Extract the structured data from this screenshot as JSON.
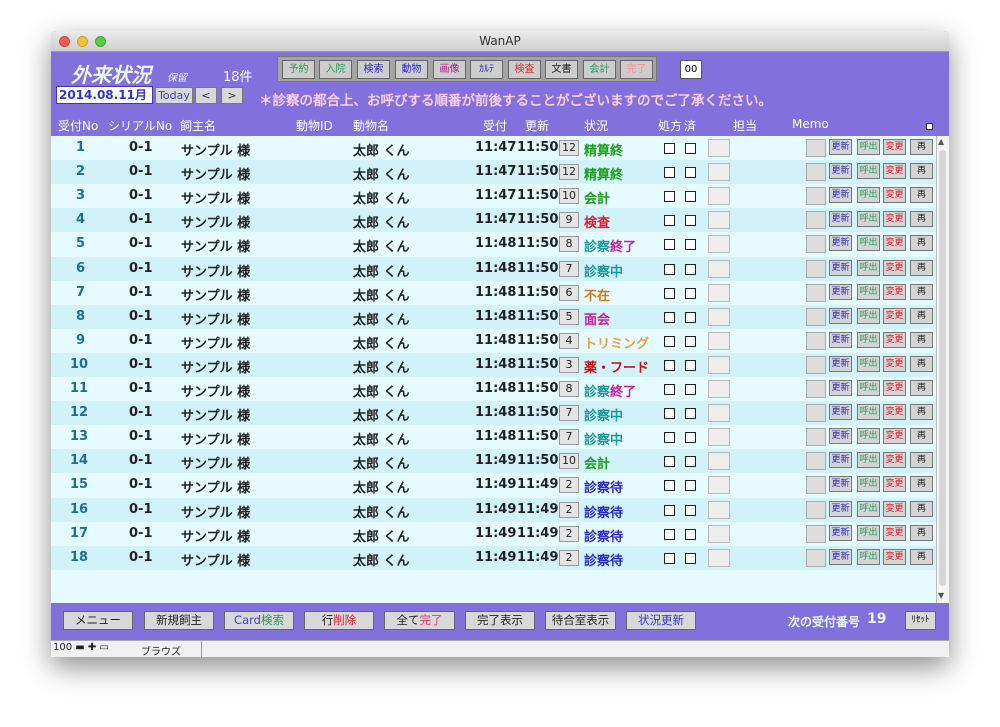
{
  "window": {
    "title": "WanAP"
  },
  "header": {
    "app_title": "外来状況",
    "hold_label": "保留",
    "count_label": "18件",
    "toolbar": [
      {
        "label": "予約",
        "color": "#2a9a55"
      },
      {
        "label": "入院",
        "color": "#2a9a55"
      },
      {
        "label": "検索",
        "color": "#2a2acc"
      },
      {
        "label": "動物",
        "color": "#2a2acc"
      },
      {
        "label": "画像",
        "color": "#b0208a"
      },
      {
        "label": "ｶﾙﾃ",
        "color": "#2a2acc"
      },
      {
        "label": "検査",
        "color": "#e03030"
      },
      {
        "label": "文書",
        "color": "#222222"
      },
      {
        "label": "会計",
        "color": "#2a9a55"
      },
      {
        "label": "完了",
        "color": "#ff9090"
      }
    ],
    "box_value": "00",
    "date": "2014.08.11月",
    "today_label": "Today",
    "prev_label": "<",
    "next_label": ">",
    "notice": "＊診察の都合上、お呼びする順番が前後することがございますのでご了承ください。"
  },
  "columns": {
    "reception_no": "受付No",
    "serial_no": "シリアルNo",
    "owner": "飼主名",
    "animal_id": "動物ID",
    "animal_name": "動物名",
    "received": "受付",
    "updated": "更新",
    "status": "状況",
    "prescription": "処方",
    "done": "済",
    "staff": "担当",
    "memo": "Memo"
  },
  "row_buttons": {
    "update": "更新",
    "call": "呼出",
    "change": "変更",
    "re": "再"
  },
  "rows": [
    {
      "no": "1",
      "serial": "0-1",
      "owner": "サンプル 様",
      "animal": "太郎 くん",
      "received": "11:47",
      "updated": "11:50",
      "code": "12",
      "status": "精算終",
      "status_color": "#1aa01a"
    },
    {
      "no": "2",
      "serial": "0-1",
      "owner": "サンプル 様",
      "animal": "太郎 くん",
      "received": "11:47",
      "updated": "11:50",
      "code": "12",
      "status": "精算終",
      "status_color": "#1aa01a"
    },
    {
      "no": "3",
      "serial": "0-1",
      "owner": "サンプル 様",
      "animal": "太郎 くん",
      "received": "11:47",
      "updated": "11:50",
      "code": "10",
      "status": "会計",
      "status_color": "#1aa01a"
    },
    {
      "no": "4",
      "serial": "0-1",
      "owner": "サンプル 様",
      "animal": "太郎 くん",
      "received": "11:47",
      "updated": "11:50",
      "code": "9",
      "status": "検査",
      "status_color": "#e0202a"
    },
    {
      "no": "5",
      "serial": "0-1",
      "owner": "サンプル 様",
      "animal": "太郎 くん",
      "received": "11:48",
      "updated": "11:50",
      "code": "8",
      "status": "診察",
      "status2": "終了",
      "status_color": "#1a9a9a",
      "status2_color": "#cc1aa0"
    },
    {
      "no": "6",
      "serial": "0-1",
      "owner": "サンプル 様",
      "animal": "太郎 くん",
      "received": "11:48",
      "updated": "11:50",
      "code": "7",
      "status": "診察中",
      "status_color": "#1a9a9a"
    },
    {
      "no": "7",
      "serial": "0-1",
      "owner": "サンプル 様",
      "animal": "太郎 くん",
      "received": "11:48",
      "updated": "11:50",
      "code": "6",
      "status": "不在",
      "status_color": "#d07a10"
    },
    {
      "no": "8",
      "serial": "0-1",
      "owner": "サンプル 様",
      "animal": "太郎 くん",
      "received": "11:48",
      "updated": "11:50",
      "code": "5",
      "status": "面会",
      "status_color": "#cc1aa0"
    },
    {
      "no": "9",
      "serial": "0-1",
      "owner": "サンプル 様",
      "animal": "太郎 くん",
      "received": "11:48",
      "updated": "11:50",
      "code": "4",
      "status": "トリミング",
      "status_color": "#f0a040"
    },
    {
      "no": "10",
      "serial": "0-1",
      "owner": "サンプル 様",
      "animal": "太郎 くん",
      "received": "11:48",
      "updated": "11:50",
      "code": "3",
      "status": "薬・フード",
      "status_color": "#cc1010"
    },
    {
      "no": "11",
      "serial": "0-1",
      "owner": "サンプル 様",
      "animal": "太郎 くん",
      "received": "11:48",
      "updated": "11:50",
      "code": "8",
      "status": "診察",
      "status2": "終了",
      "status_color": "#1a9a9a",
      "status2_color": "#cc1aa0"
    },
    {
      "no": "12",
      "serial": "0-1",
      "owner": "サンプル 様",
      "animal": "太郎 くん",
      "received": "11:48",
      "updated": "11:50",
      "code": "7",
      "status": "診察中",
      "status_color": "#1a9a9a"
    },
    {
      "no": "13",
      "serial": "0-1",
      "owner": "サンプル 様",
      "animal": "太郎 くん",
      "received": "11:48",
      "updated": "11:50",
      "code": "7",
      "status": "診察中",
      "status_color": "#1a9a9a"
    },
    {
      "no": "14",
      "serial": "0-1",
      "owner": "サンプル 様",
      "animal": "太郎 くん",
      "received": "11:49",
      "updated": "11:50",
      "code": "10",
      "status": "会計",
      "status_color": "#1aa01a"
    },
    {
      "no": "15",
      "serial": "0-1",
      "owner": "サンプル 様",
      "animal": "太郎 くん",
      "received": "11:49",
      "updated": "11:49",
      "code": "2",
      "status": "診察待",
      "status_color": "#2a2acc"
    },
    {
      "no": "16",
      "serial": "0-1",
      "owner": "サンプル 様",
      "animal": "太郎 くん",
      "received": "11:49",
      "updated": "11:49",
      "code": "2",
      "status": "診察待",
      "status_color": "#2a2acc"
    },
    {
      "no": "17",
      "serial": "0-1",
      "owner": "サンプル 様",
      "animal": "太郎 くん",
      "received": "11:49",
      "updated": "11:49",
      "code": "2",
      "status": "診察待",
      "status_color": "#2a2acc"
    },
    {
      "no": "18",
      "serial": "0-1",
      "owner": "サンプル 様",
      "animal": "太郎 くん",
      "received": "11:49",
      "updated": "11:49",
      "code": "2",
      "status": "診察待",
      "status_color": "#2a2acc"
    }
  ],
  "footer": {
    "menu": "メニュー",
    "new_owner": "新規飼主",
    "card_search_a": "Card",
    "card_search_b": "検索",
    "row_delete_a": "行",
    "row_delete_b": "削除",
    "all_done_a": "全て",
    "all_done_b": "完了",
    "show_done": "完了表示",
    "waiting_room": "待合室表示",
    "status_update": "状況更新",
    "next_no_label": "次の受付番号",
    "next_no": "19",
    "reset": "ﾘｾｯﾄ"
  },
  "statusbar": {
    "zoom": "100",
    "mode": "ブラウズ"
  }
}
